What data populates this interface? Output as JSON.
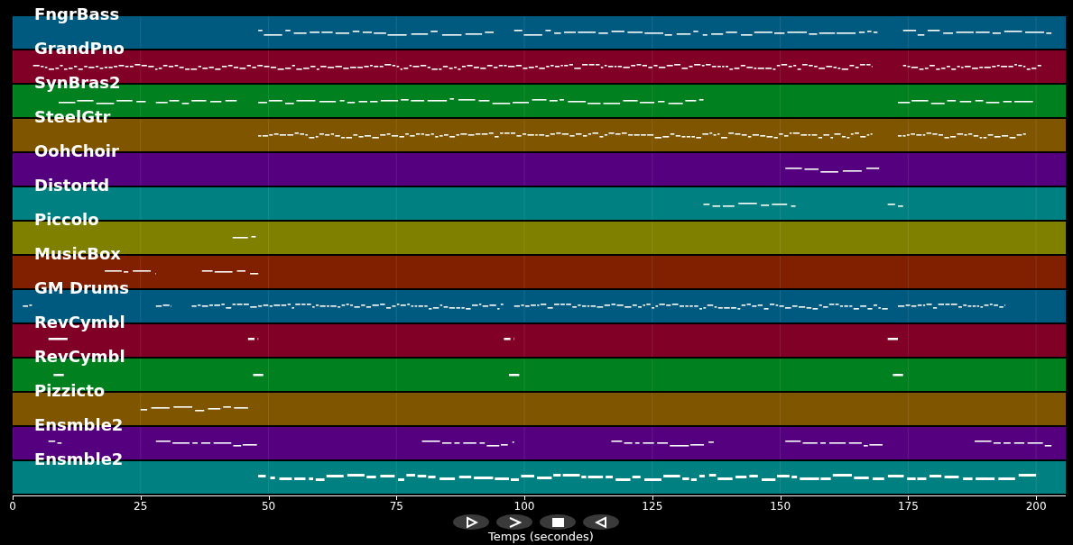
{
  "tracks": [
    {
      "name": "FngrBass",
      "color": "#005a80"
    },
    {
      "name": "GrandPno",
      "color": "#800026"
    },
    {
      "name": "SynBras2",
      "color": "#00801e"
    },
    {
      "name": "SteelGtr",
      "color": "#805500"
    },
    {
      "name": "OohChoir",
      "color": "#55007f"
    },
    {
      "name": "Distortd",
      "color": "#008080"
    },
    {
      "name": "Piccolo",
      "color": "#808000"
    },
    {
      "name": "MusicBox",
      "color": "#802000"
    },
    {
      "name": "GM Drums",
      "color": "#005a80"
    },
    {
      "name": "RevCymbl",
      "color": "#800026"
    },
    {
      "name": "RevCymbl",
      "color": "#00801e"
    },
    {
      "name": "Pizzicto",
      "color": "#805500"
    },
    {
      "name": "Ensmble2",
      "color": "#55007f"
    },
    {
      "name": "Ensmble2",
      "color": "#008080"
    }
  ],
  "x_axis": {
    "ticks": [
      "0",
      "25",
      "50",
      "75",
      "100",
      "125",
      "150",
      "175",
      "200"
    ],
    "label": "Temps (secondes)"
  },
  "controls": [
    {
      "kind": "play"
    },
    {
      "kind": "forward"
    },
    {
      "kind": "stop"
    },
    {
      "kind": "reverse"
    }
  ]
}
